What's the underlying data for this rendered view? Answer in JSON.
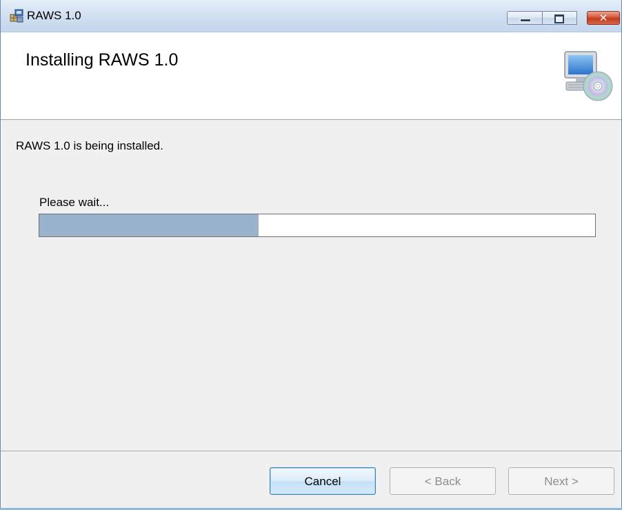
{
  "window": {
    "title": "RAWS 1.0",
    "controls": {
      "minimize_icon": "minimize-icon",
      "maximize_icon": "maximize-icon",
      "close_glyph": "✕"
    }
  },
  "banner": {
    "title": "Installing RAWS 1.0",
    "icon": "computer-cd-icon"
  },
  "body": {
    "status": "RAWS 1.0 is being installed.",
    "wait_label": "Please wait...",
    "progress_fraction": 0.395
  },
  "buttons": {
    "cancel": "Cancel",
    "back": "< Back",
    "next": "Next >"
  },
  "colors": {
    "progress_fill": "#99b3cf",
    "close_button": "#c13a1b",
    "focused_button_border": "#3c7fb1"
  }
}
